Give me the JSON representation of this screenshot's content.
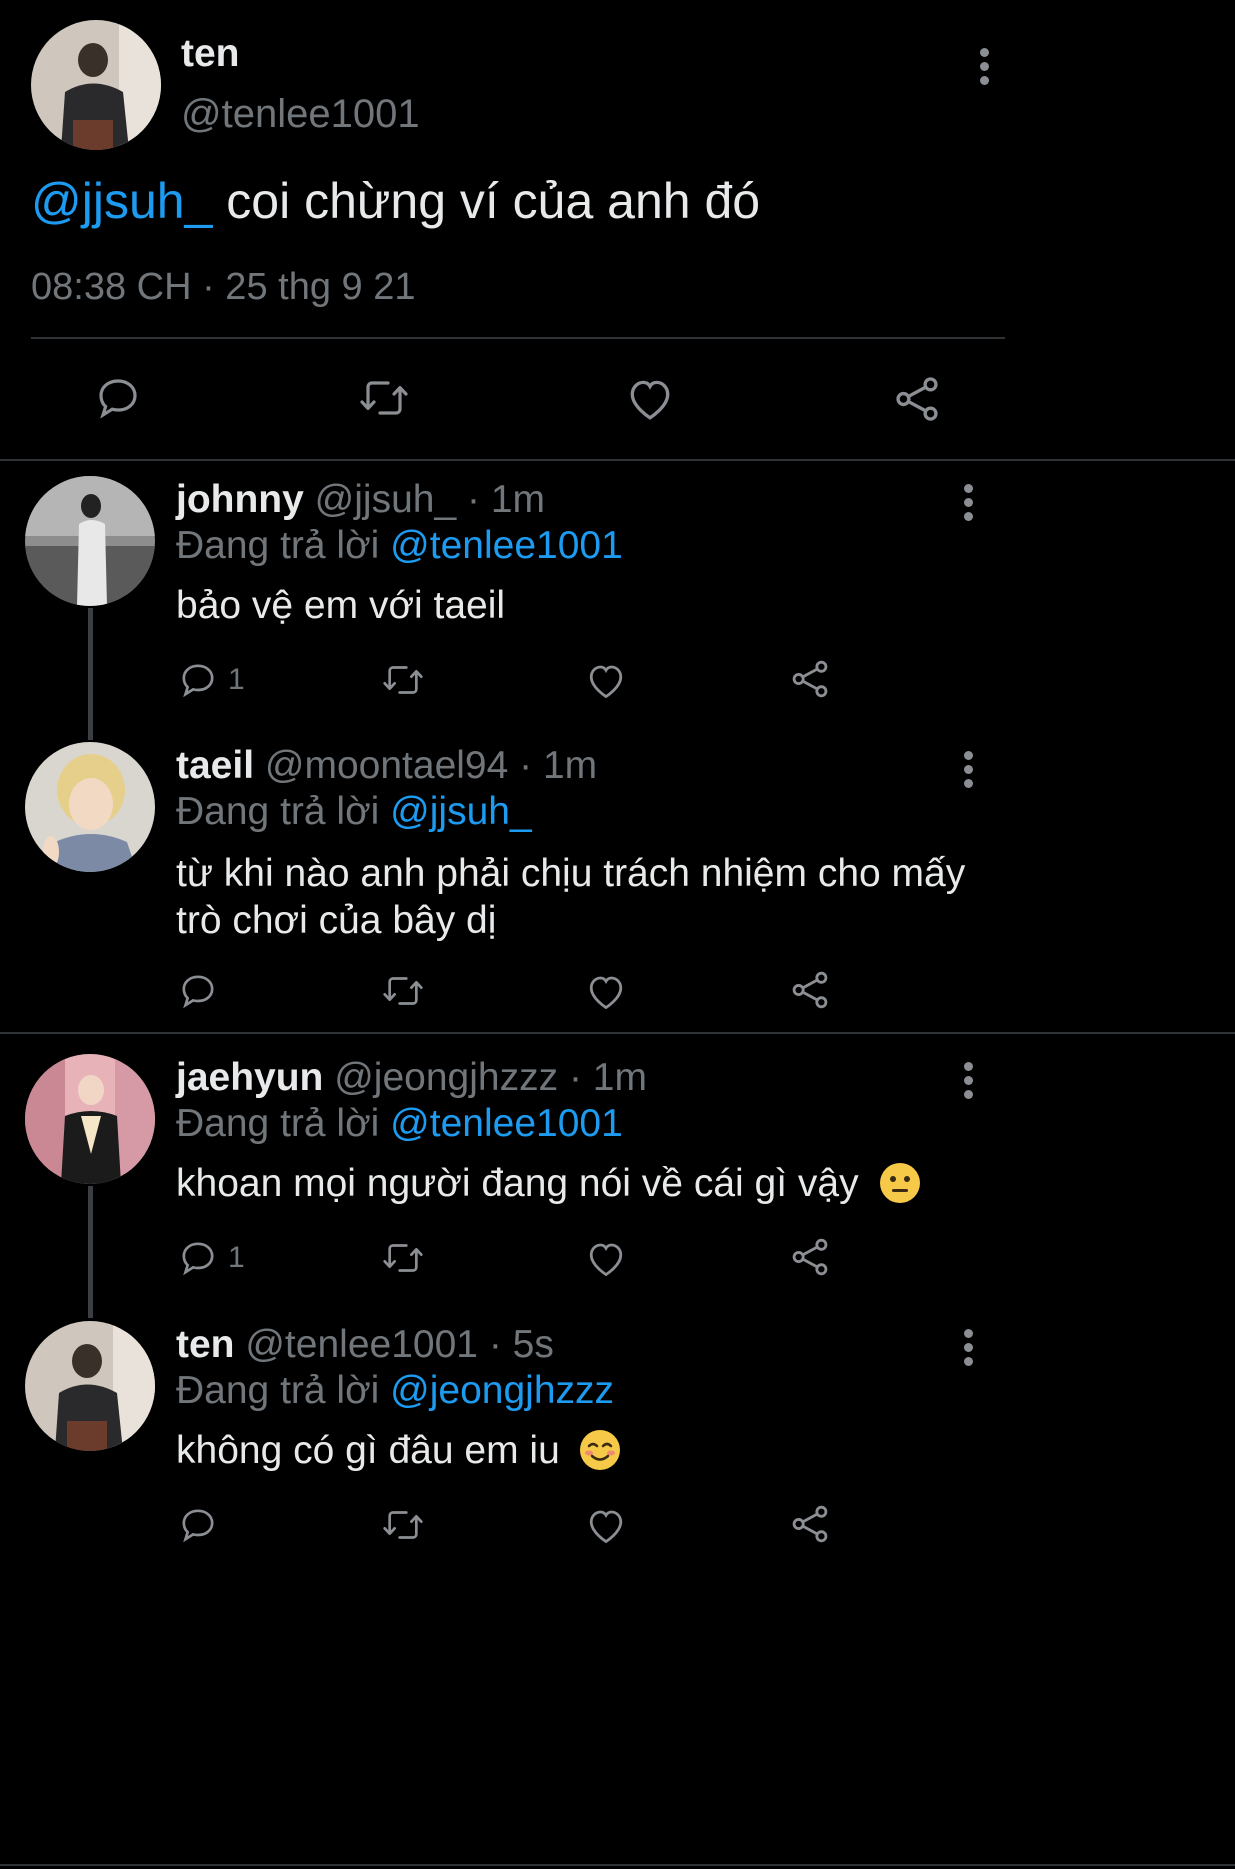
{
  "main_tweet": {
    "display_name": "ten",
    "handle": "@tenlee1001",
    "mention": "@jjsuh_",
    "text": " coi chừng ví của anh đó",
    "timestamp": "08:38 CH · 25 thg 9 21"
  },
  "replies": [
    {
      "display_name": "johnny",
      "handle": "@jjsuh_",
      "time": "· 1m",
      "replying_prefix": "Đang trả lời",
      "replying_to": "@tenlee1001",
      "text_lines": [
        "bảo vệ em với taeil"
      ],
      "reply_count": "1"
    },
    {
      "display_name": "taeil",
      "handle": "@moontael94",
      "time": "· 1m",
      "replying_prefix": "Đang trả lời",
      "replying_to": "@jjsuh_",
      "text_lines": [
        "từ khi nào anh phải chịu trách nhiệm cho mấy",
        "trò chơi của bây dị"
      ],
      "reply_count": ""
    },
    {
      "display_name": "jaehyun",
      "handle": "@jeongjhzzz",
      "time": "· 1m",
      "replying_prefix": "Đang trả lời",
      "replying_to": "@tenlee1001",
      "text_lines": [
        "khoan mọi người đang nói về cái gì vậy"
      ],
      "emoji": "neutral-face-emoji",
      "reply_count": "1"
    },
    {
      "display_name": "ten",
      "handle": "@tenlee1001",
      "time": "· 5s",
      "replying_prefix": "Đang trả lời",
      "replying_to": "@jeongjhzzz",
      "text_lines": [
        "không có gì đâu em iu"
      ],
      "emoji": "smiling-blush-emoji",
      "reply_count": ""
    }
  ],
  "colors": {
    "background": "#000000",
    "text": "#e7e9ea",
    "muted": "#71767b",
    "link": "#1d9bf0",
    "divider": "#2f3336"
  }
}
